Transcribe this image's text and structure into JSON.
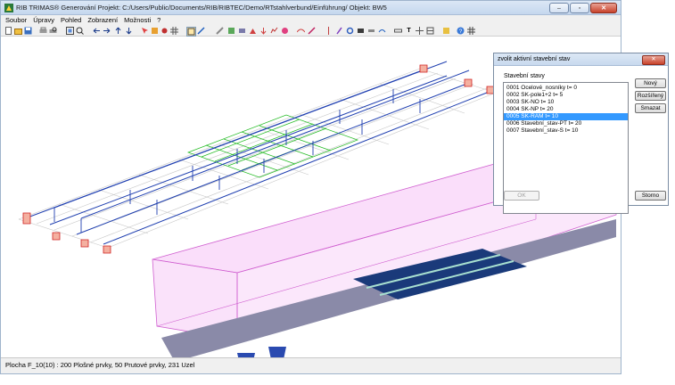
{
  "window": {
    "title": "RIB TRIMAS® Generování Projekt: C:/Users/Public/Documents/RIB/RIBTEC/Demo/RTstahlverbund/Einführung/ Objekt: BW5",
    "controls": {
      "minimize": "–",
      "maximize": "▫",
      "close": "✕"
    }
  },
  "menu": [
    "Soubor",
    "Úpravy",
    "Pohled",
    "Zobrazení",
    "Možnosti",
    "?"
  ],
  "toolbar": {
    "icons": [
      "new-file-icon",
      "open-folder-icon",
      "save-icon",
      "print-icon",
      "print-preview-icon",
      "zoom-extents-icon",
      "zoom-icon",
      "arrow-left-icon",
      "arrow-right-icon",
      "arrow-up-icon",
      "arrow-down-icon",
      "select-icon",
      "move-icon",
      "node-icon",
      "grid-icon",
      "view-icon",
      "line-icon",
      "mesh-icon",
      "layers-icon",
      "render-icon",
      "support-icon",
      "load-icon",
      "result-icon",
      "color-icon",
      "deform-icon",
      "pointer-icon",
      "node-tool-icon",
      "element-tool-icon",
      "section-icon",
      "table-icon",
      "spring-icon",
      "dimension-icon",
      "text-icon",
      "measure-icon",
      "zoom-window-icon",
      "palette-icon",
      "help-icon",
      "tools-icon"
    ],
    "text_glyphs": {
      "text": "T"
    }
  },
  "status": {
    "text": "Plocha F_10(10) : 200 Plošné prvky, 50 Prutové prvky, 231 Uzel"
  },
  "dialog": {
    "title": "zvolit aktivní stavební stav",
    "close_glyph": "✕",
    "group_label": "Stavební stavy",
    "items": [
      "0001 Ocelové_nosníky  t= 0",
      "0002 SK-pole1+2  t= 5",
      "0003 SK-NO  t= 10",
      "0004 SK-NP  t= 20",
      "0005 SK-RAM  t= 10",
      "0006 Stavební_stav-PT  t= 20",
      "0007 Stavební_stav-S  t= 10"
    ],
    "selected_index": 4,
    "buttons": {
      "new": "Nový",
      "extended": "Rozšířený",
      "delete": "Smazat",
      "ok": "OK",
      "cancel": "Storno"
    }
  },
  "colors": {
    "titlebar": "#c5d7ee",
    "selection": "#3399ff",
    "grid_green": "#22bb22",
    "beam_blue": "#1f3fb0",
    "support_red": "#d02020",
    "slab_pink": "#f0a0f0",
    "deck_gray": "#8a8aa8"
  }
}
